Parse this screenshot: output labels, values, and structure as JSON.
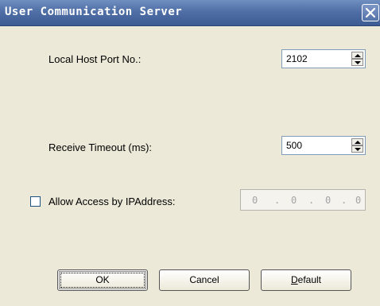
{
  "window": {
    "title": "User Communication Server"
  },
  "fields": {
    "local_port": {
      "label": "Local Host Port No.:",
      "value": "2102"
    },
    "receive_timeout": {
      "label": "Receive Timeout (ms):",
      "value": "500"
    },
    "allow_ip": {
      "label": "Allow Access by IPAddress:",
      "checked": false,
      "octets": [
        "0",
        "0",
        "0",
        "0"
      ],
      "separators": [
        ".",
        ".",
        "."
      ]
    }
  },
  "buttons": {
    "ok": "OK",
    "cancel": "Cancel",
    "default": "Default"
  },
  "icons": {
    "close": "close-icon",
    "spin_up": "chevron-up-icon",
    "spin_down": "chevron-down-icon"
  },
  "colors": {
    "titlebar": "#4f6fa6",
    "dialog_bg": "#ece9d8",
    "disabled_text": "#a5a5a5"
  }
}
